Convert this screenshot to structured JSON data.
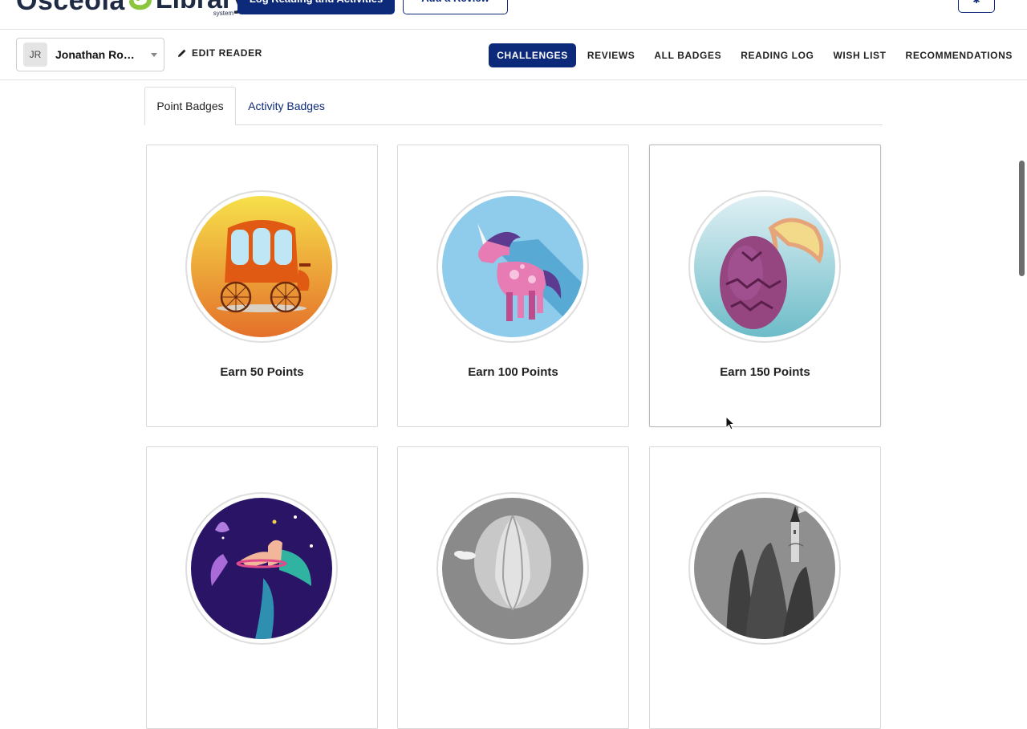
{
  "header": {
    "logo_word1": "Osceola",
    "logo_word2": "Library",
    "logo_sub": "system",
    "log_button": "Log Reading and Activities",
    "review_button": "Add a Review",
    "gear_icon": "gear-icon"
  },
  "reader": {
    "initials": "JR",
    "name": "Jonathan Rob..."
  },
  "nav": {
    "edit_reader": "EDIT READER",
    "links": [
      "CHALLENGES",
      "REVIEWS",
      "ALL BADGES",
      "READING LOG",
      "WISH LIST",
      "RECOMMENDATIONS"
    ],
    "active": "CHALLENGES"
  },
  "tabs": {
    "point": "Point Badges",
    "activity": "Activity Badges"
  },
  "badges": [
    {
      "label": "Earn 50 Points",
      "icon": "carriage-icon"
    },
    {
      "label": "Earn 100 Points",
      "icon": "unicorn-icon"
    },
    {
      "label": "Earn 150 Points",
      "icon": "dragon-egg-icon"
    },
    {
      "label": "",
      "icon": "mermaid-icon"
    },
    {
      "label": "",
      "icon": "hot-air-balloon-icon"
    },
    {
      "label": "",
      "icon": "castle-icon"
    }
  ],
  "colors": {
    "brand": "#0d2a7a",
    "logo_green": "#8cc63f"
  }
}
